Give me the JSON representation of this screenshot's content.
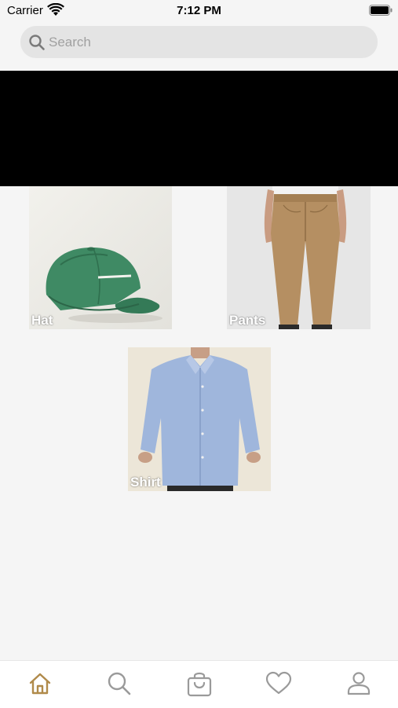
{
  "status_bar": {
    "carrier": "Carrier",
    "time": "7:12 PM"
  },
  "search": {
    "placeholder": "Search",
    "value": ""
  },
  "products": [
    {
      "label": "Hat",
      "icon": "green-cap-image"
    },
    {
      "label": "Pants",
      "icon": "khaki-pants-image"
    },
    {
      "label": "Shirt",
      "icon": "blue-shirt-image"
    }
  ],
  "tab_bar": {
    "active_color": "#b08a4a",
    "inactive_color": "#9a9a9a",
    "tabs": [
      "home-icon",
      "search-icon",
      "bag-icon",
      "heart-icon",
      "profile-icon"
    ]
  }
}
